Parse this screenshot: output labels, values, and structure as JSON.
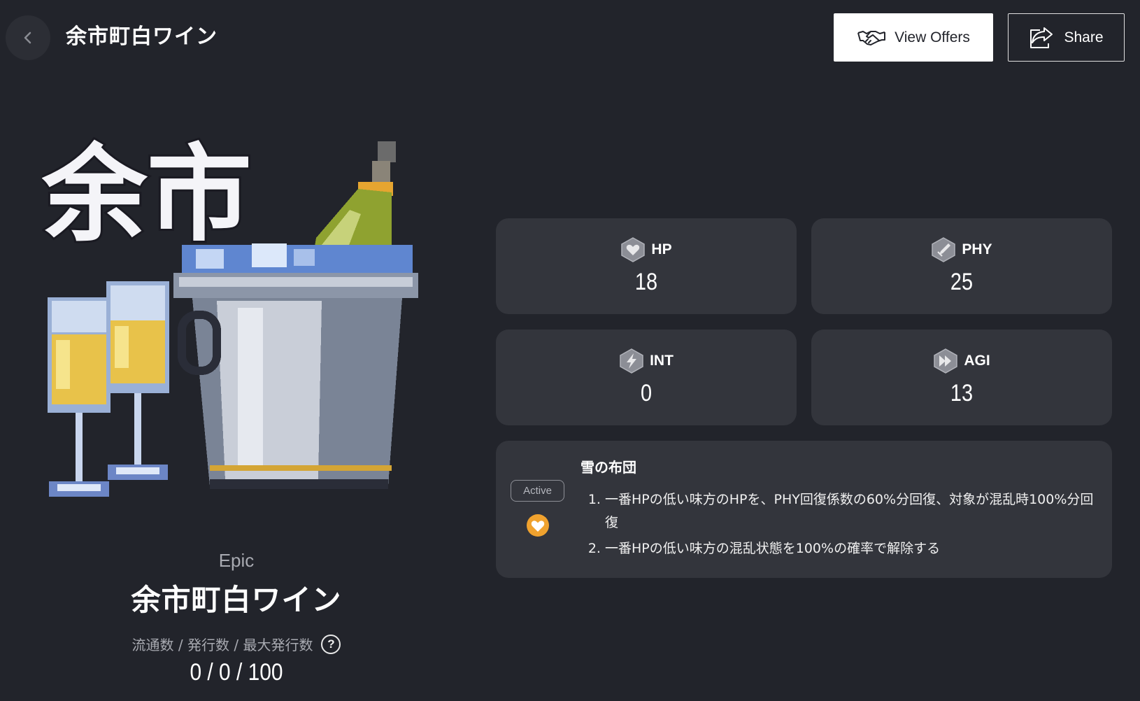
{
  "header": {
    "title": "余市町白ワイン",
    "view_offers_label": "View Offers",
    "share_label": "Share"
  },
  "card": {
    "rarity": "Epic",
    "name": "余市町白ワイン",
    "supply_label": "流通数 / 発行数 / 最大発行数",
    "supply_values": "0 / 0 / 100",
    "art_text": "余市"
  },
  "stats": [
    {
      "label": "HP",
      "value": "18",
      "icon": "heart-gem-icon"
    },
    {
      "label": "PHY",
      "value": "25",
      "icon": "sword-gem-icon"
    },
    {
      "label": "INT",
      "value": "0",
      "icon": "lightning-gem-icon"
    },
    {
      "label": "AGI",
      "value": "13",
      "icon": "fast-forward-gem-icon"
    }
  ],
  "skill": {
    "type": "Active",
    "name": "雪の布団",
    "effects": [
      "一番HPの低い味方のHPを、PHY回復係数の60%分回復、対象が混乱時100%分回復",
      "一番HPの低い味方の混乱状態を100%の確率で解除する"
    ],
    "icon": "heart-orange-icon"
  },
  "colors": {
    "background": "#22242b",
    "card": "#33353c",
    "accent_orange": "#f0a22e"
  }
}
